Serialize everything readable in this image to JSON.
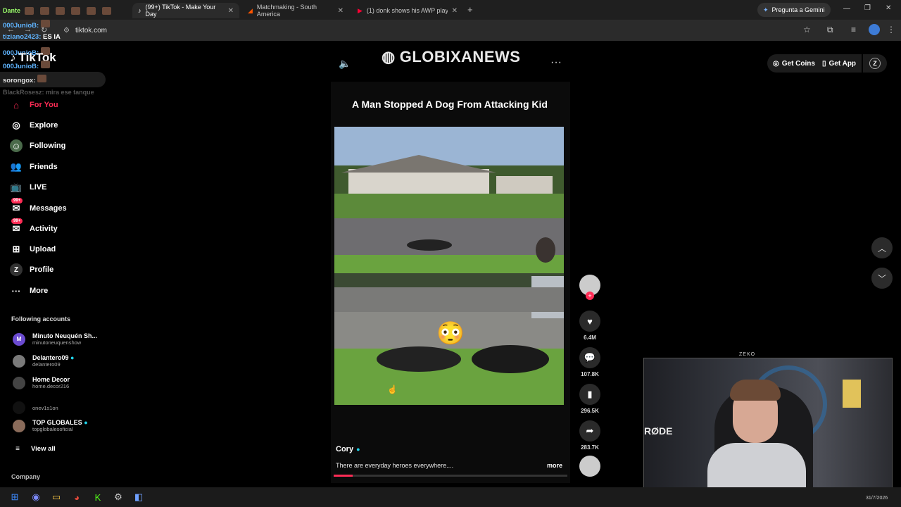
{
  "tabs": [
    {
      "label": "Dante",
      "active": false
    },
    {
      "label": "(99+) TikTok - Make Your Day",
      "active": true
    },
    {
      "label": "Matchmaking - South America",
      "active": false
    },
    {
      "label": "(1) donk shows his AWP play in",
      "active": false
    }
  ],
  "gemini_label": "Pregunta a Gemini",
  "url": "tiktok.com",
  "chat": [
    {
      "user": "000JunioB:",
      "msg": ""
    },
    {
      "user": "tiziano2423:",
      "msg": "ES IA"
    },
    {
      "user": "000JunioB:",
      "msg": ""
    },
    {
      "user": "000JunioB:",
      "msg": ""
    },
    {
      "user": "sorongox:",
      "msg": ""
    },
    {
      "user": "BlackRosesz:",
      "msg": "mira ese tanque"
    }
  ],
  "brand": "TikTok",
  "nav": [
    {
      "label": "For You",
      "icon": "home-icon",
      "active": true
    },
    {
      "label": "Explore",
      "icon": "compass-icon"
    },
    {
      "label": "Following",
      "icon": "following-icon"
    },
    {
      "label": "Friends",
      "icon": "friends-icon"
    },
    {
      "label": "LIVE",
      "icon": "live-icon"
    },
    {
      "label": "Messages",
      "icon": "messages-icon",
      "badge": "99+"
    },
    {
      "label": "Activity",
      "icon": "activity-icon",
      "badge": "99+"
    },
    {
      "label": "Upload",
      "icon": "upload-icon"
    },
    {
      "label": "Profile",
      "icon": "profile-icon"
    },
    {
      "label": "More",
      "icon": "more-icon"
    }
  ],
  "following_heading": "Following accounts",
  "accounts": [
    {
      "name": "Minuto Neuquén Sh...",
      "handle": "minutoneuquenshow",
      "initial": "M",
      "color": "#6b4bd1"
    },
    {
      "name": "Delantero09",
      "handle": "delantero09",
      "verified": true,
      "color": "#7a7a7a"
    },
    {
      "name": "Home Decor",
      "handle": "home.decor216",
      "color": "#444"
    },
    {
      "name": "",
      "handle": "onev1s1on",
      "color": "#222"
    },
    {
      "name": "TOP GLOBALES",
      "handle": "topglobalesoficial",
      "verified": true,
      "color": "#8a6b5a"
    }
  ],
  "view_all": "View all",
  "company": "Company",
  "header": {
    "channel_logo": "GLOBIXANEWS",
    "get_coins": "Get Coins",
    "get_app": "Get App"
  },
  "video": {
    "title": "A Man Stopped A Dog From Attacking Kid",
    "author": "Cory",
    "description": "There are everyday heroes everywhere....",
    "more": "more",
    "emoji": "😳",
    "progress": 0.08
  },
  "actions": {
    "likes": "6.4M",
    "comments": "107.8K",
    "saves": "296.5K",
    "shares": "283.7K"
  },
  "webcam": {
    "brand_text": "RØDE",
    "top_label": "ZEKO"
  },
  "taskbar": {
    "date": "31/7/2026"
  }
}
